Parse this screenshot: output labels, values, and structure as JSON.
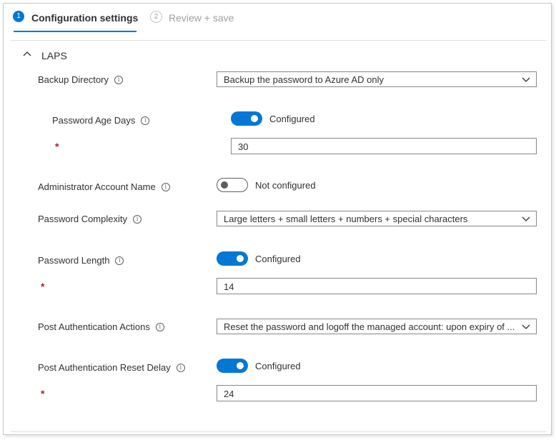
{
  "tabs": [
    {
      "number": "1",
      "label": "Configuration settings",
      "active": true
    },
    {
      "number": "2",
      "label": "Review + save",
      "active": false
    }
  ],
  "section": {
    "title": "LAPS",
    "collapse_icon": "chevron-up-icon"
  },
  "info_glyph": "i",
  "required_marker": "*",
  "fields": {
    "backup_directory": {
      "label": "Backup Directory",
      "value": "Backup the password to Azure AD only"
    },
    "password_age_days": {
      "label": "Password Age Days",
      "toggle_label": "Configured",
      "toggle_state": true,
      "value": "30"
    },
    "admin_account_name": {
      "label": "Administrator Account Name",
      "toggle_label": "Not configured",
      "toggle_state": false
    },
    "password_complexity": {
      "label": "Password Complexity",
      "value": "Large letters + small letters + numbers + special characters"
    },
    "password_length": {
      "label": "Password Length",
      "toggle_label": "Configured",
      "toggle_state": true,
      "value": "14"
    },
    "post_auth_actions": {
      "label": "Post Authentication Actions",
      "value": "Reset the password and logoff the managed account: upon expiry of ..."
    },
    "post_auth_reset_delay": {
      "label": "Post Authentication Reset Delay",
      "toggle_label": "Configured",
      "toggle_state": true,
      "value": "24"
    }
  },
  "colors": {
    "accent": "#0078d4",
    "required": "#a4262c",
    "text": "#323130",
    "border": "#8a8886"
  }
}
